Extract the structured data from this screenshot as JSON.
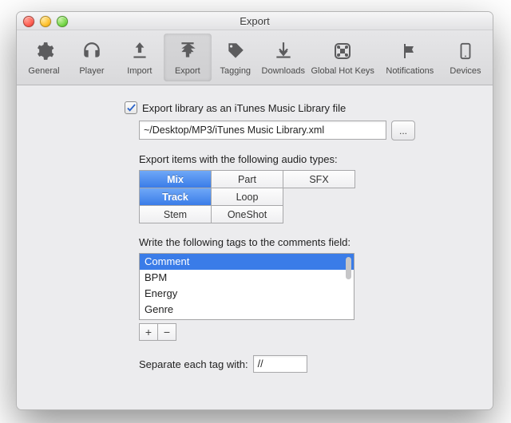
{
  "window": {
    "title": "Export"
  },
  "toolbar": {
    "items": [
      {
        "label": "General"
      },
      {
        "label": "Player"
      },
      {
        "label": "Import"
      },
      {
        "label": "Export"
      },
      {
        "label": "Tagging"
      },
      {
        "label": "Downloads"
      },
      {
        "label": "Global Hot Keys"
      },
      {
        "label": "Notifications"
      },
      {
        "label": "Devices"
      }
    ]
  },
  "export": {
    "checkbox_label": "Export library as an iTunes Music Library file",
    "path": "~/Desktop/MP3/iTunes Music Library.xml",
    "browse_label": "...",
    "types_label": "Export items with the following audio types:",
    "types": {
      "mix": "Mix",
      "part": "Part",
      "sfx": "SFX",
      "track": "Track",
      "loop": "Loop",
      "stem": "Stem",
      "oneshot": "OneShot"
    },
    "tags_label": "Write the following tags to the comments field:",
    "tag_list": [
      "Comment",
      "BPM",
      "Energy",
      "Genre"
    ],
    "plus": "+",
    "minus": "−",
    "separator_label": "Separate each tag with:",
    "separator_value": "//"
  }
}
